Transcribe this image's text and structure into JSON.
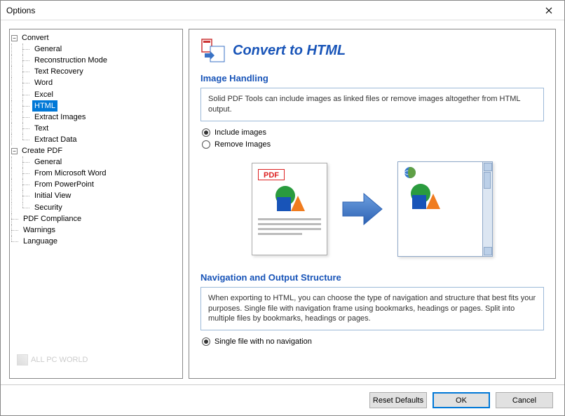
{
  "window": {
    "title": "Options"
  },
  "tree": {
    "convert": {
      "label": "Convert",
      "items": [
        "General",
        "Reconstruction Mode",
        "Text Recovery",
        "Word",
        "Excel",
        "HTML",
        "Extract Images",
        "Text",
        "Extract Data"
      ],
      "selected": "HTML"
    },
    "createPdf": {
      "label": "Create PDF",
      "items": [
        "General",
        "From Microsoft Word",
        "From PowerPoint",
        "Initial View",
        "Security"
      ]
    },
    "flat": [
      "PDF Compliance",
      "Warnings",
      "Language"
    ]
  },
  "watermark": "ALL PC WORLD",
  "page": {
    "title": "Convert to HTML",
    "sections": {
      "imageHandling": {
        "title": "Image Handling",
        "desc": "Solid PDF Tools can include images as linked files or remove images altogether from HTML output.",
        "options": [
          {
            "label": "Include images",
            "selected": true
          },
          {
            "label": "Remove Images",
            "selected": false
          }
        ]
      },
      "navOutput": {
        "title": "Navigation and Output Structure",
        "desc": "When exporting to HTML, you can choose the type of navigation and structure that best fits your purposes. Single file with navigation frame using bookmarks, headings or pages. Split into multiple files by bookmarks, headings or pages.",
        "options": [
          {
            "label": "Single file with no navigation",
            "selected": true
          }
        ]
      }
    },
    "pdfBadge": "PDF"
  },
  "footer": {
    "resetDefaults": "Reset Defaults",
    "ok": "OK",
    "cancel": "Cancel"
  }
}
